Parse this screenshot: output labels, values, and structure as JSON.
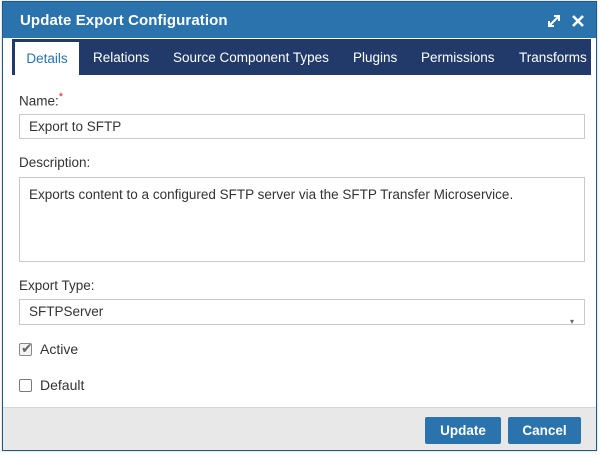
{
  "dialog": {
    "title": "Update Export Configuration",
    "icons": [
      "expand-icon",
      "close-icon"
    ]
  },
  "tabs": [
    {
      "label": "Details",
      "active": true
    },
    {
      "label": "Relations",
      "active": false
    },
    {
      "label": "Source Component Types",
      "active": false
    },
    {
      "label": "Plugins",
      "active": false
    },
    {
      "label": "Permissions",
      "active": false
    },
    {
      "label": "Transforms",
      "active": false
    }
  ],
  "form": {
    "name": {
      "label": "Name:",
      "required_marker": "*",
      "value": "Export to SFTP"
    },
    "description": {
      "label": "Description:",
      "value": "Exports content to a configured SFTP server via the SFTP Transfer Microservice."
    },
    "export_type": {
      "label": "Export Type:",
      "value": "SFTPServer"
    },
    "active": {
      "label": "Active",
      "checked": true
    },
    "default": {
      "label": "Default",
      "checked": false
    }
  },
  "footer": {
    "update_label": "Update",
    "cancel_label": "Cancel"
  },
  "colors": {
    "titlebar": "#2a73ad",
    "tabbar": "#213a6a",
    "button": "#2a73ad",
    "footer": "#e8e8e8",
    "required": "#d6262e"
  }
}
